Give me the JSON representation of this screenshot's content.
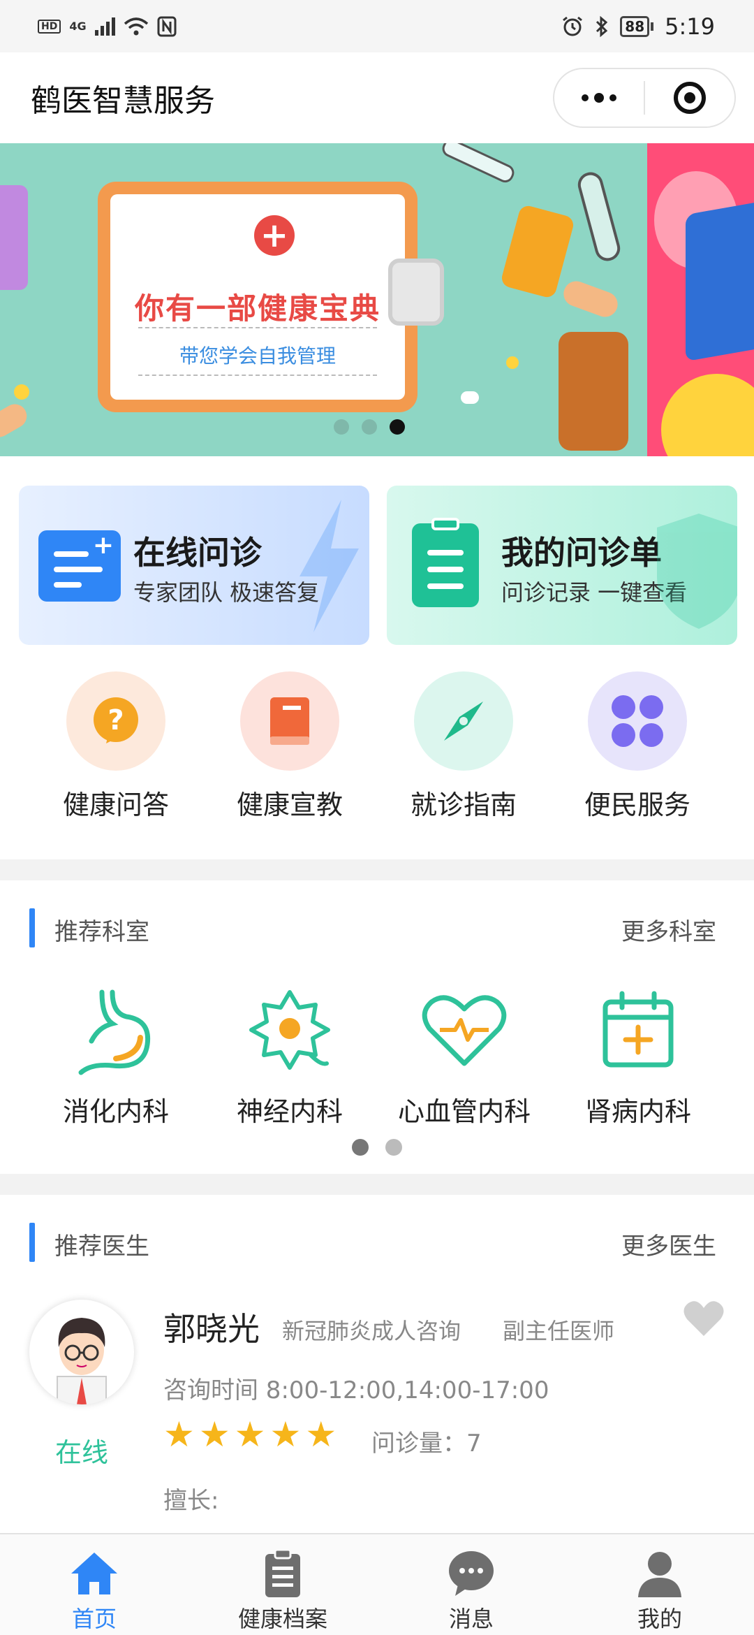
{
  "status_bar": {
    "network_badge": "HD",
    "network_type": "4G",
    "battery": "88",
    "time": "5:19"
  },
  "title_bar": {
    "title": "鹤医智慧服务",
    "more_icon": "more-dots-icon",
    "close_icon": "target-icon"
  },
  "banner": {
    "title": "你有一部健康宝典",
    "subtitle": "带您学会自我管理",
    "page_count": 3,
    "active_page": 3
  },
  "features": [
    {
      "title": "在线问诊",
      "subtitle": "专家团队 极速答复",
      "icon": "chat-plus-icon",
      "color": "#2f86f6"
    },
    {
      "title": "我的问诊单",
      "subtitle": "问诊记录 一键查看",
      "icon": "clipboard-icon",
      "color": "#1fc196"
    }
  ],
  "quick_links": [
    {
      "label": "健康问答",
      "icon": "question-icon"
    },
    {
      "label": "健康宣教",
      "icon": "book-icon"
    },
    {
      "label": "就诊指南",
      "icon": "compass-icon"
    },
    {
      "label": "便民服务",
      "icon": "grid-icon"
    }
  ],
  "departments": {
    "title": "推荐科室",
    "more": "更多科室",
    "items": [
      {
        "label": "消化内科",
        "icon": "stomach-icon"
      },
      {
        "label": "神经内科",
        "icon": "neuron-icon"
      },
      {
        "label": "心血管内科",
        "icon": "heart-pulse-icon"
      },
      {
        "label": "肾病内科",
        "icon": "calendar-plus-icon"
      }
    ],
    "page_count": 2,
    "active_page": 1
  },
  "doctors": {
    "title": "推荐医生",
    "more": "更多医生",
    "items": [
      {
        "name": "郭晓光",
        "specialty": "新冠肺炎成人咨询",
        "rank": "副主任医师",
        "time": "咨询时间 8:00-12:00,14:00-17:00",
        "stars": 5,
        "count": "问诊量：7",
        "good_at": "擅长:",
        "status": "在线"
      }
    ]
  },
  "tabs": [
    {
      "label": "首页",
      "icon": "home-icon",
      "active": true
    },
    {
      "label": "健康档案",
      "icon": "clipboard-icon",
      "active": false
    },
    {
      "label": "消息",
      "icon": "chat-bubble-icon",
      "active": false
    },
    {
      "label": "我的",
      "icon": "user-icon",
      "active": false
    }
  ],
  "colors": {
    "primary": "#2f86f6",
    "green": "#1fc196",
    "online": "#2ec29a",
    "star": "#f6b51a"
  }
}
